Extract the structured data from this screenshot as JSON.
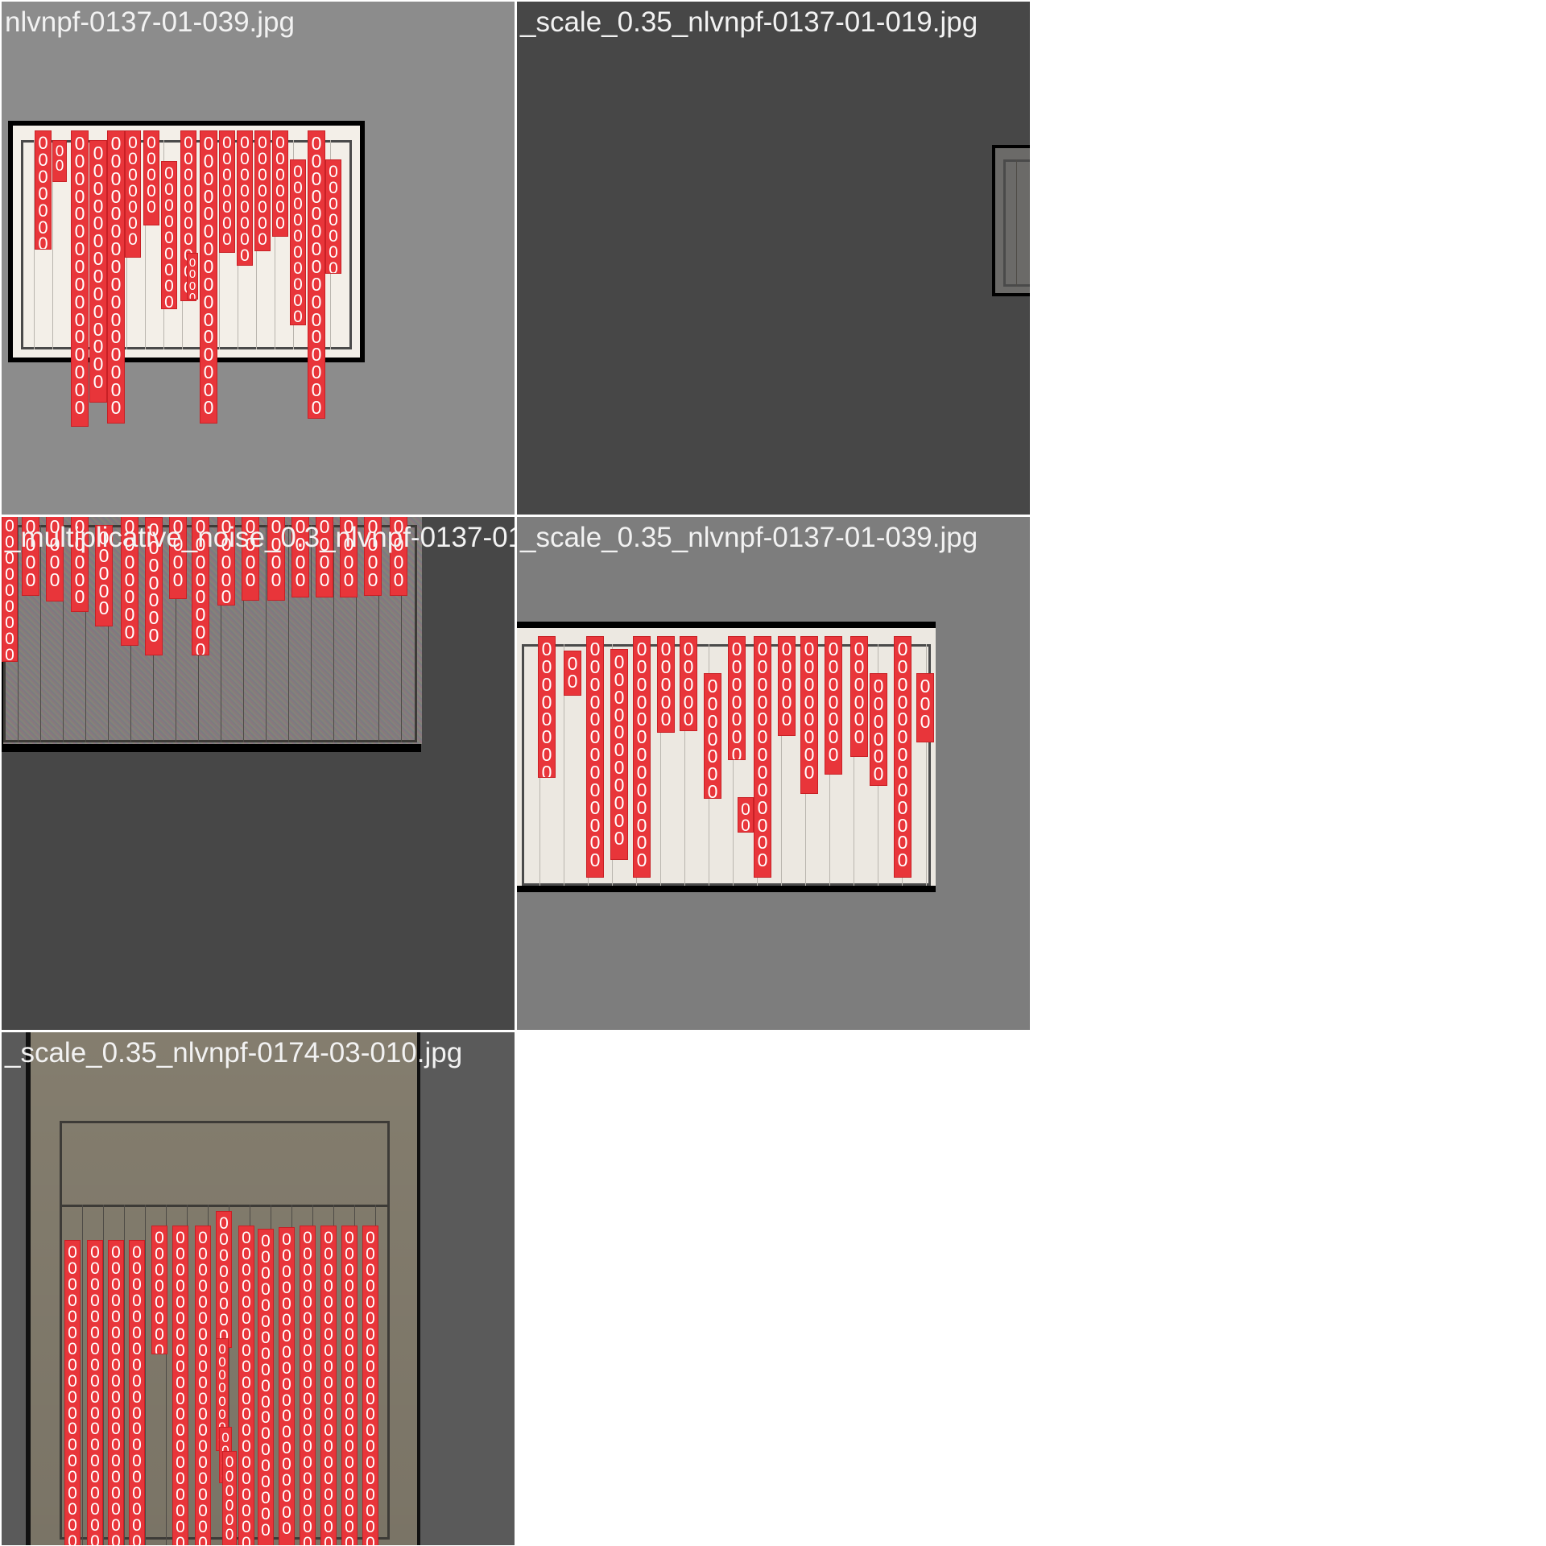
{
  "colors": {
    "box_fill": "#e8353a",
    "box_glyph": "#ffffff",
    "label_text": "#f2f2f2"
  },
  "box_glyph": "0",
  "tiles": [
    {
      "label": "nlvnpf-0137-01-039.jpg",
      "background": "#8c8c8c",
      "page": "#f3efe8"
    },
    {
      "label": "_scale_0.35_nlvnpf-0137-01-019.jpg",
      "background": "#474747",
      "page": "#6b6a68"
    },
    {
      "label": "_multiplicative_noise_0.3_nlvnpf-0137-01",
      "background": "#474747",
      "page": "#807a78"
    },
    {
      "label": "_scale_0.35_nlvnpf-0137-01-039.jpg",
      "background": "#7d7d7d",
      "page": "#ece8e1"
    },
    {
      "label": "_scale_0.35_nlvnpf-0174-03-010.jpg",
      "background": "#5a5a5a",
      "page": "#8b8474"
    }
  ]
}
